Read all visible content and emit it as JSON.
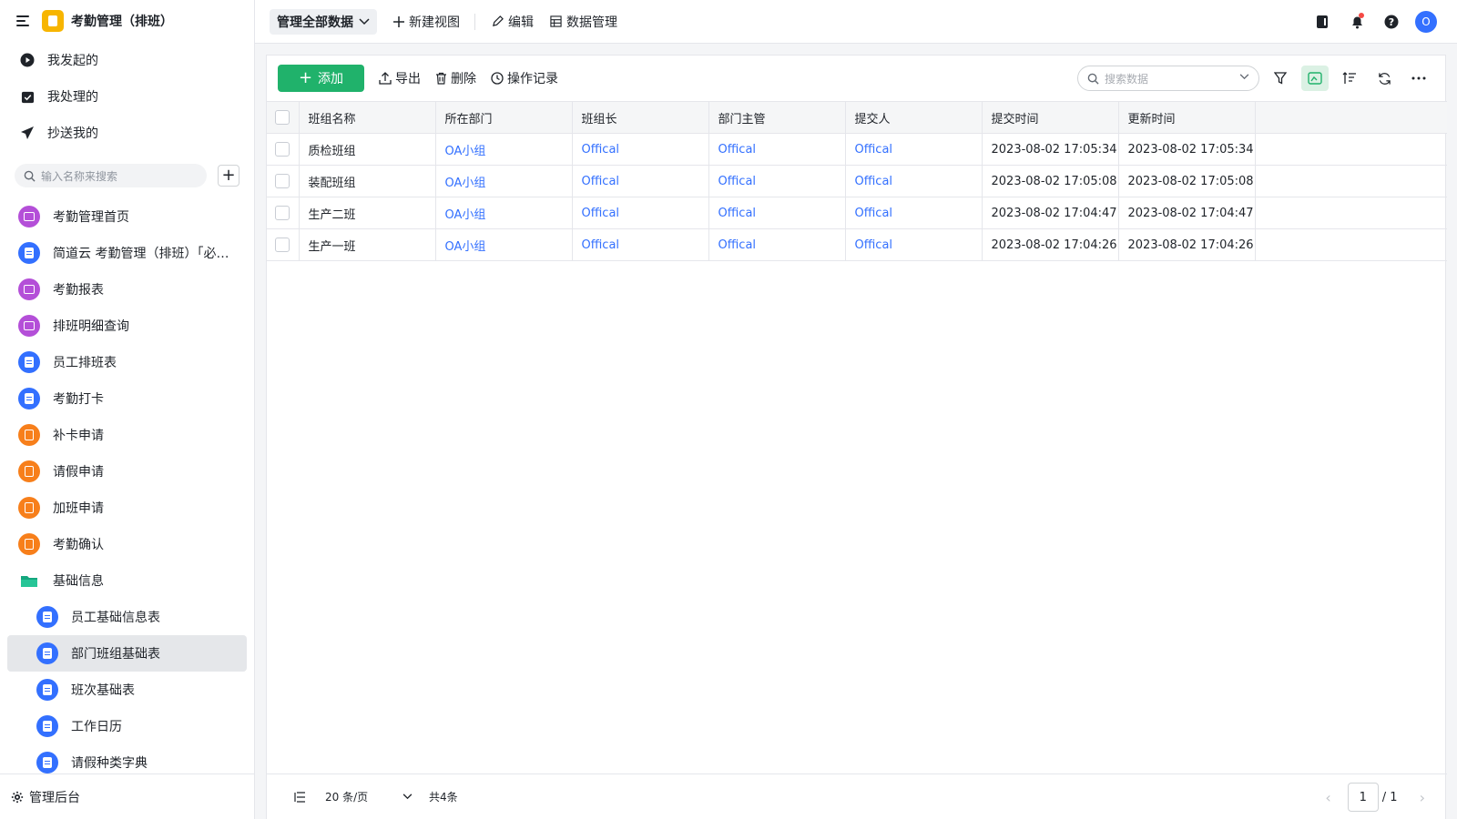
{
  "app": {
    "title": "考勤管理（排班）",
    "accent": "#20b26b"
  },
  "quick": [
    {
      "label": "我发起的",
      "icon": "play-circle-icon"
    },
    {
      "label": "我处理的",
      "icon": "check-box-icon"
    },
    {
      "label": "抄送我的",
      "icon": "send-icon"
    }
  ],
  "sidebar_search": {
    "placeholder": "输入名称来搜索"
  },
  "nav": [
    {
      "label": "考勤管理首页",
      "color": "purple",
      "kind": "chart"
    },
    {
      "label": "简道云 考勤管理（排班）「必…",
      "color": "blue",
      "kind": "doc"
    },
    {
      "label": "考勤报表",
      "color": "purple",
      "kind": "chart"
    },
    {
      "label": "排班明细查询",
      "color": "purple",
      "kind": "chart"
    },
    {
      "label": "员工排班表",
      "color": "blue",
      "kind": "doc"
    },
    {
      "label": "考勤打卡",
      "color": "blue",
      "kind": "doc"
    },
    {
      "label": "补卡申请",
      "color": "orange",
      "kind": "form"
    },
    {
      "label": "请假申请",
      "color": "orange",
      "kind": "form"
    },
    {
      "label": "加班申请",
      "color": "orange",
      "kind": "form"
    },
    {
      "label": "考勤确认",
      "color": "orange",
      "kind": "form"
    },
    {
      "label": "基础信息",
      "color": "folder",
      "kind": "folder"
    },
    {
      "label": "员工基础信息表",
      "color": "blue",
      "kind": "doc",
      "sub": true
    },
    {
      "label": "部门班组基础表",
      "color": "blue",
      "kind": "doc",
      "sub": true,
      "active": true
    },
    {
      "label": "班次基础表",
      "color": "blue",
      "kind": "doc",
      "sub": true
    },
    {
      "label": "工作日历",
      "color": "blue",
      "kind": "doc",
      "sub": true
    },
    {
      "label": "请假种类字典",
      "color": "blue",
      "kind": "doc",
      "sub": true
    }
  ],
  "admin": {
    "label": "管理后台"
  },
  "topbar": {
    "view_label": "管理全部数据",
    "new_view": "新建视图",
    "edit": "编辑",
    "data_manage": "数据管理",
    "avatar": "O"
  },
  "toolbar": {
    "add": "添加",
    "export": "导出",
    "delete": "删除",
    "log": "操作记录",
    "search_placeholder": "搜索数据"
  },
  "table": {
    "columns": [
      "班组名称",
      "所在部门",
      "班组长",
      "部门主管",
      "提交人",
      "提交时间",
      "更新时间"
    ],
    "rows": [
      [
        "质检班组",
        "OA小组",
        "Offical",
        "Offical",
        "Offical",
        "2023-08-02 17:05:34",
        "2023-08-02 17:05:34"
      ],
      [
        "装配班组",
        "OA小组",
        "Offical",
        "Offical",
        "Offical",
        "2023-08-02 17:05:08",
        "2023-08-02 17:05:08"
      ],
      [
        "生产二班",
        "OA小组",
        "Offical",
        "Offical",
        "Offical",
        "2023-08-02 17:04:47",
        "2023-08-02 17:04:47"
      ],
      [
        "生产一班",
        "OA小组",
        "Offical",
        "Offical",
        "Offical",
        "2023-08-02 17:04:26",
        "2023-08-02 17:04:26"
      ]
    ]
  },
  "pager": {
    "page_size": "20 条/页",
    "total": "共4条",
    "current": "1",
    "pages": "/ 1"
  }
}
